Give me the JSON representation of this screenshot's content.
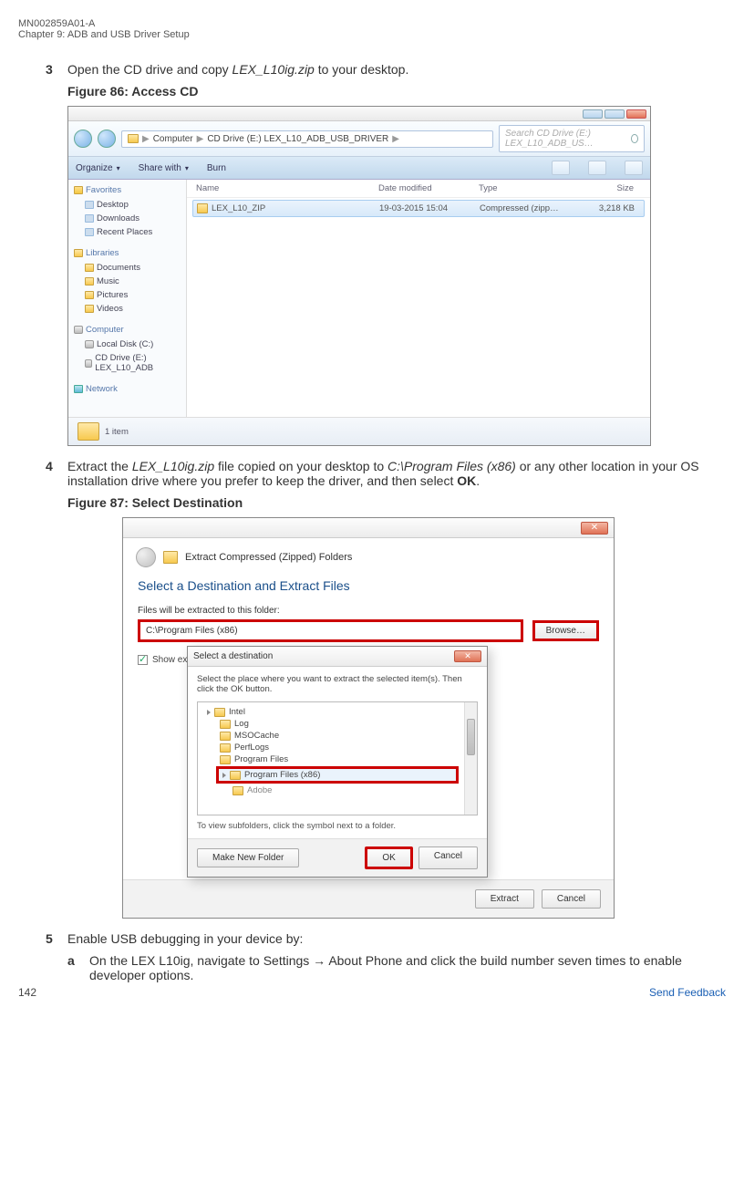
{
  "doc_header": {
    "code": "MN002859A01-A",
    "chapter": "Chapter 9:  ADB and USB Driver Setup"
  },
  "steps": {
    "s3": {
      "num": "3",
      "text_before": "Open the CD drive and copy ",
      "italic": "LEX_L10ig.zip",
      "text_after": " to your desktop."
    },
    "fig86_caption": "Figure 86: Access CD",
    "s4": {
      "num": "4",
      "t1": "Extract the ",
      "italic1": "LEX_L10ig.zip",
      "t2": " file copied on your desktop to ",
      "italic2": "C:\\Program Files (x86)",
      "t3": " or any other location in your OS installation drive where you prefer to keep the driver, and then select ",
      "bold": "OK",
      "t4": "."
    },
    "fig87_caption": "Figure 87: Select Destination",
    "s5": {
      "num": "5",
      "text": "Enable USB debugging in your device by:"
    },
    "s5a": {
      "num": "a",
      "t1": "On the LEX L10ig, navigate to ",
      "bold1": "Settings",
      "arrow": " → ",
      "bold2": "About Phone",
      "t2": " and click the build number seven times to enable developer options."
    }
  },
  "fig86": {
    "address_parts": {
      "p1": "Computer",
      "p2": "CD Drive (E:) LEX_L10_ADB_USB_DRIVER"
    },
    "search_placeholder": "Search CD Drive (E:) LEX_L10_ADB_US…",
    "toolbar": {
      "organize": "Organize",
      "share": "Share with",
      "burn": "Burn"
    },
    "sidebar": {
      "favorites": "Favorites",
      "desktop": "Desktop",
      "downloads": "Downloads",
      "recent": "Recent Places",
      "libraries": "Libraries",
      "documents": "Documents",
      "music": "Music",
      "pictures": "Pictures",
      "videos": "Videos",
      "computer": "Computer",
      "localdisk": "Local Disk (C:)",
      "cddrive": "CD Drive (E:) LEX_L10_ADB",
      "network": "Network"
    },
    "columns": {
      "name": "Name",
      "date": "Date modified",
      "type": "Type",
      "size": "Size"
    },
    "file": {
      "name": "LEX_L10_ZIP",
      "date": "19-03-2015 15:04",
      "type": "Compressed (zipp…",
      "size": "3,218 KB"
    },
    "status": "1 item"
  },
  "fig87": {
    "wizard_title": "Extract Compressed (Zipped) Folders",
    "big_title": "Select a Destination and Extract Files",
    "label": "Files will be extracted to this folder:",
    "path": "C:\\Program Files (x86)",
    "browse": "Browse…",
    "show_checkbox": "Show extract",
    "extract_btn": "Extract",
    "cancel_btn": "Cancel",
    "inner": {
      "title": "Select a destination",
      "instruction": "Select the place where you want to extract the selected item(s).  Then click the OK button.",
      "tree": {
        "intel": "Intel",
        "log": "Log",
        "msocache": "MSOCache",
        "perflogs": "PerfLogs",
        "progfiles": "Program Files",
        "progfilesx86": "Program Files (x86)",
        "adobe": "Adobe"
      },
      "hint": "To view subfolders, click the symbol next to a folder.",
      "make_new": "Make New Folder",
      "ok": "OK",
      "cancel": "Cancel"
    }
  },
  "footer": {
    "page": "142",
    "feedback": "Send Feedback"
  }
}
